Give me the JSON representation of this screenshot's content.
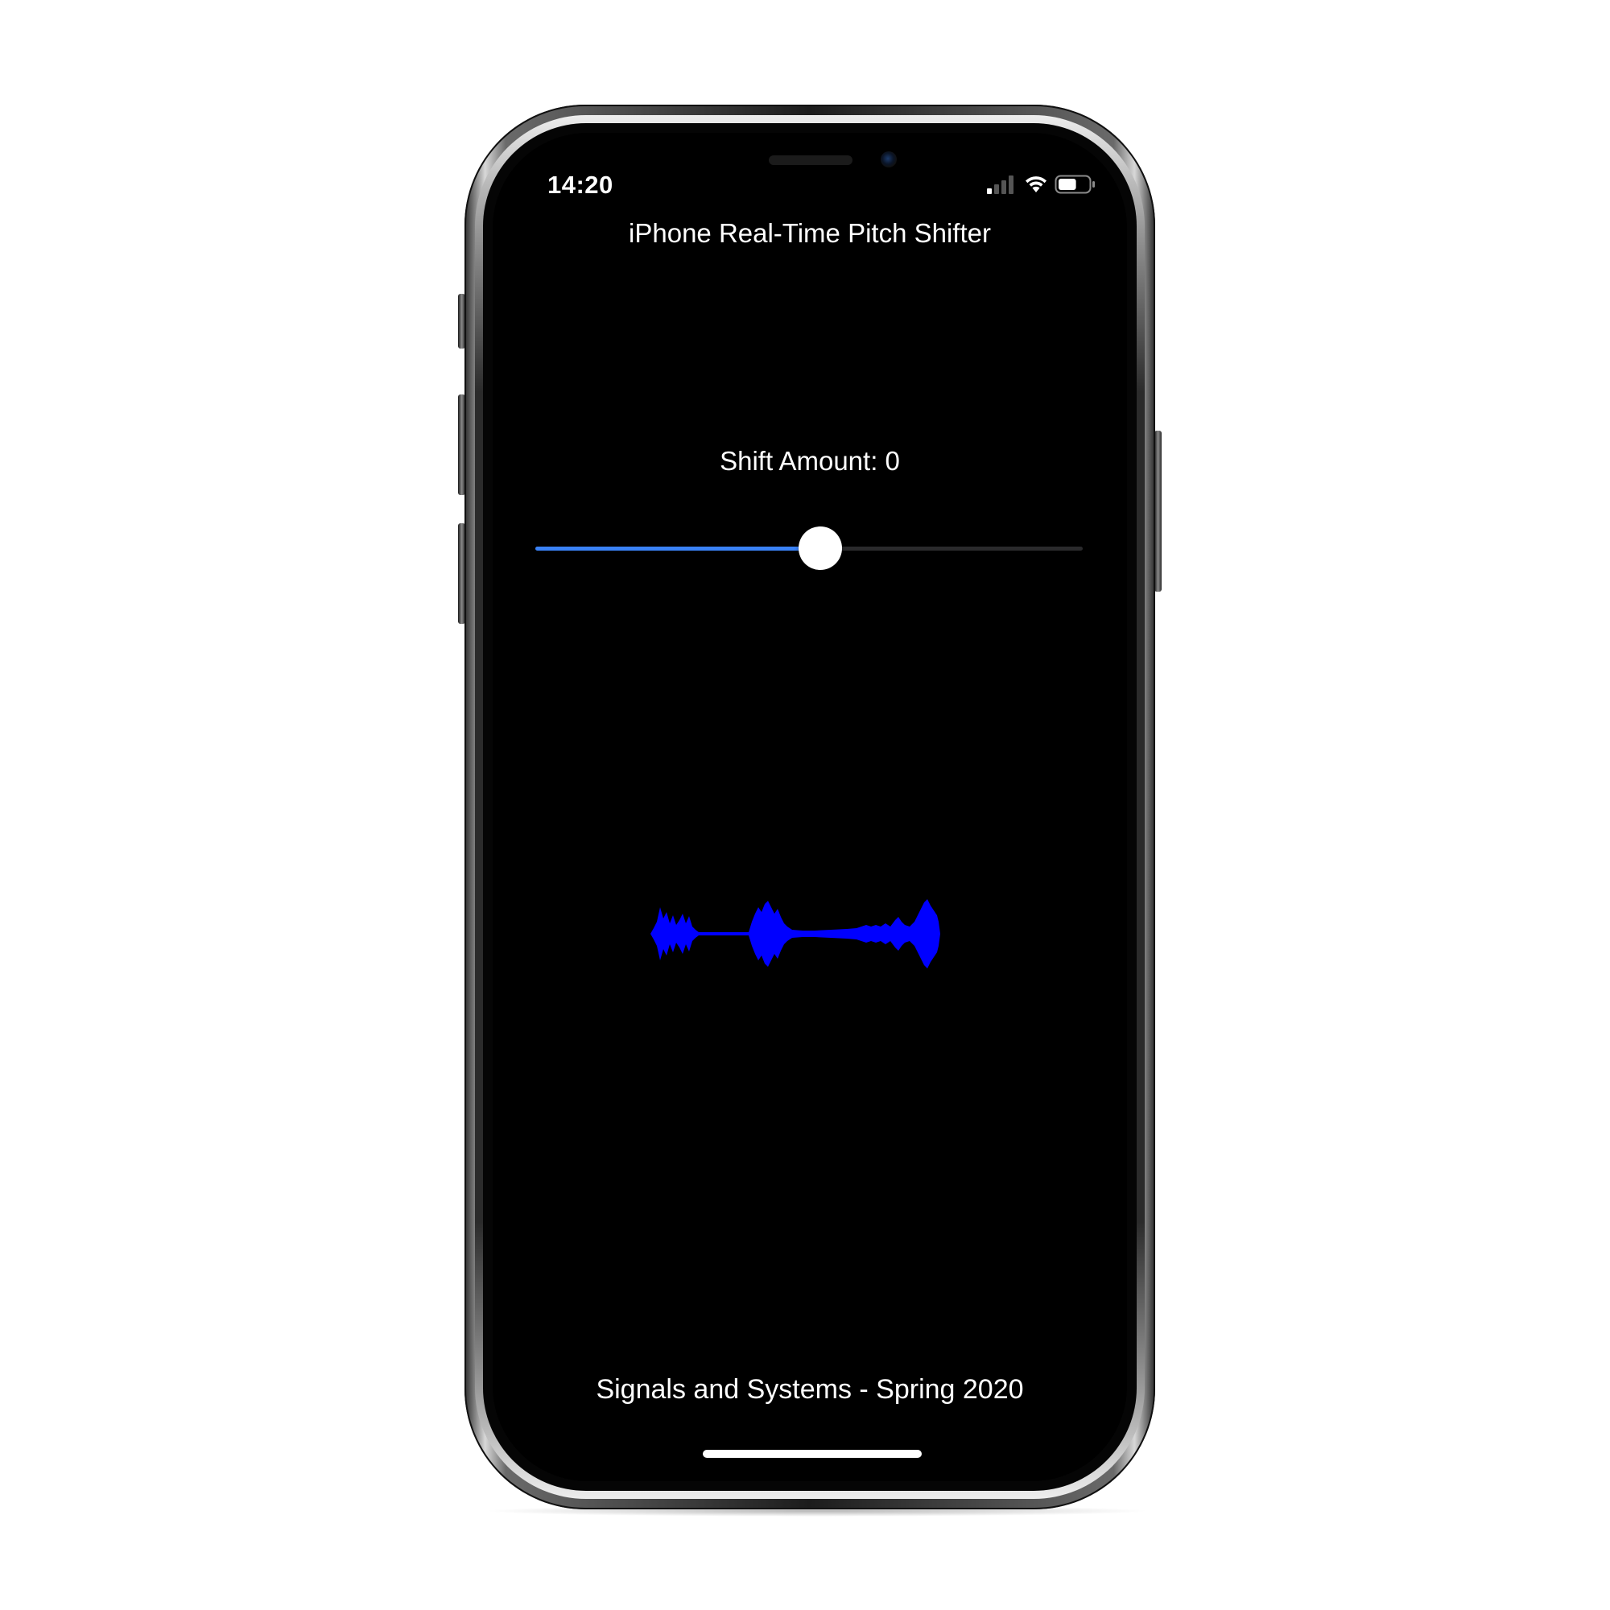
{
  "status_bar": {
    "time": "14:20",
    "icons": [
      "cellular-signal-icon",
      "wifi-icon",
      "battery-icon"
    ],
    "battery_level": 0.6
  },
  "app": {
    "title": "iPhone Real-Time Pitch Shifter",
    "shift_label": "Shift Amount: 0",
    "slider": {
      "value": 0,
      "fraction": 0.52,
      "track_color": "#2a2a2c",
      "fill_color": "#3a82f7",
      "thumb_color": "#ffffff"
    },
    "waveform": {
      "color": "#0000ff"
    },
    "footer": "Signals and Systems - Spring 2020"
  }
}
